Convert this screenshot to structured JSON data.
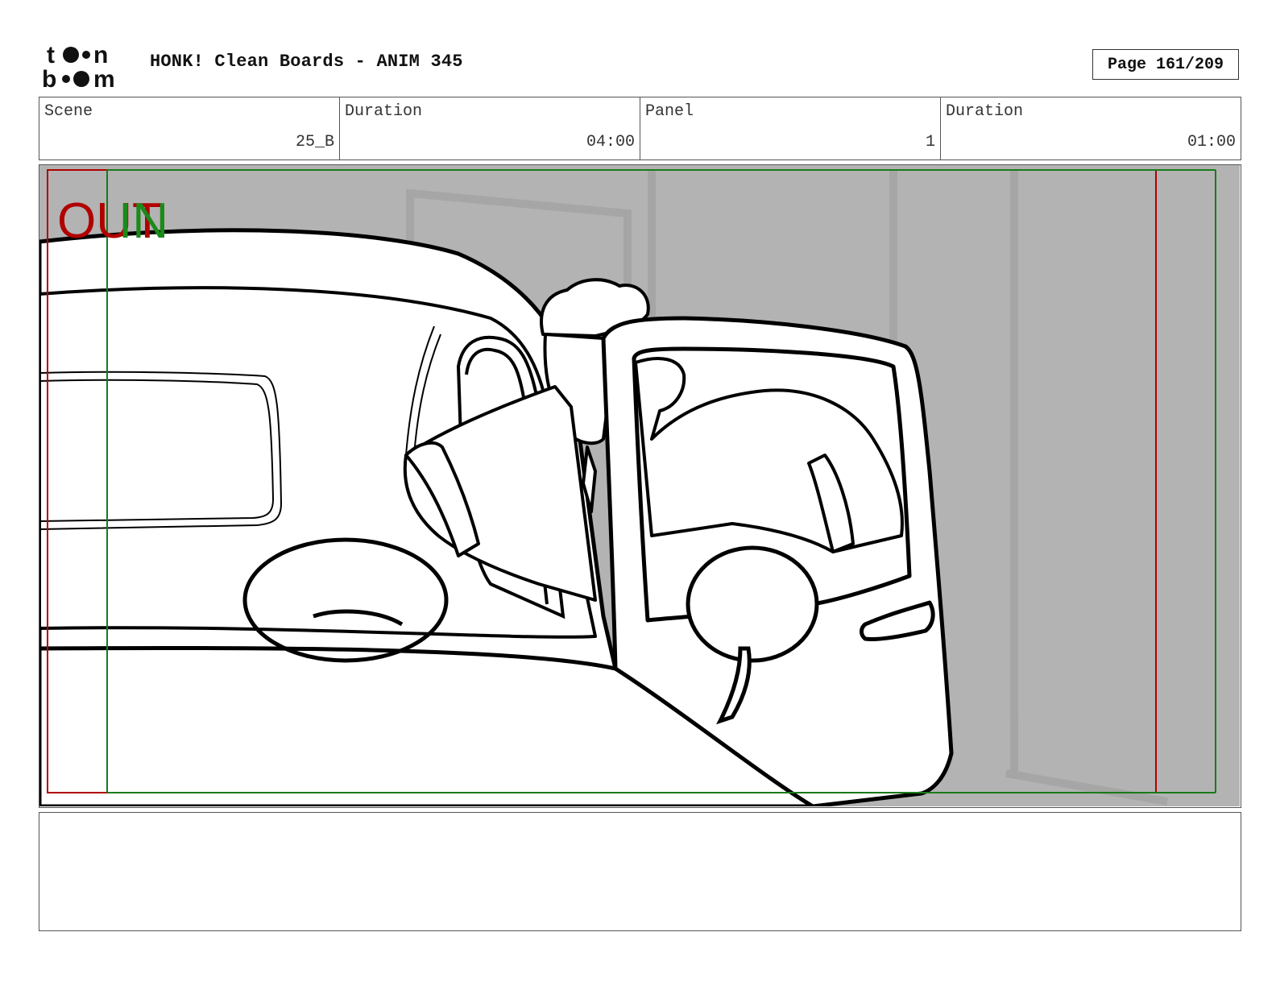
{
  "header": {
    "logo_text": "toon boom",
    "title": "HONK! Clean Boards - ANIM 345",
    "page_label": "Page 161/209"
  },
  "info": {
    "scene_label": "Scene",
    "scene_value": "25_B",
    "duration_label": "Duration",
    "duration_value": "04:00",
    "panel_label": "Panel",
    "panel_value": "1",
    "panel_duration_label": "Duration",
    "panel_duration_value": "01:00"
  },
  "panel": {
    "out_label": "OUT",
    "in_label": "IN",
    "out_color": "#b00000",
    "in_color": "#1a8a1a",
    "background_color": "#b3b3b3"
  },
  "notes": {
    "text": ""
  }
}
